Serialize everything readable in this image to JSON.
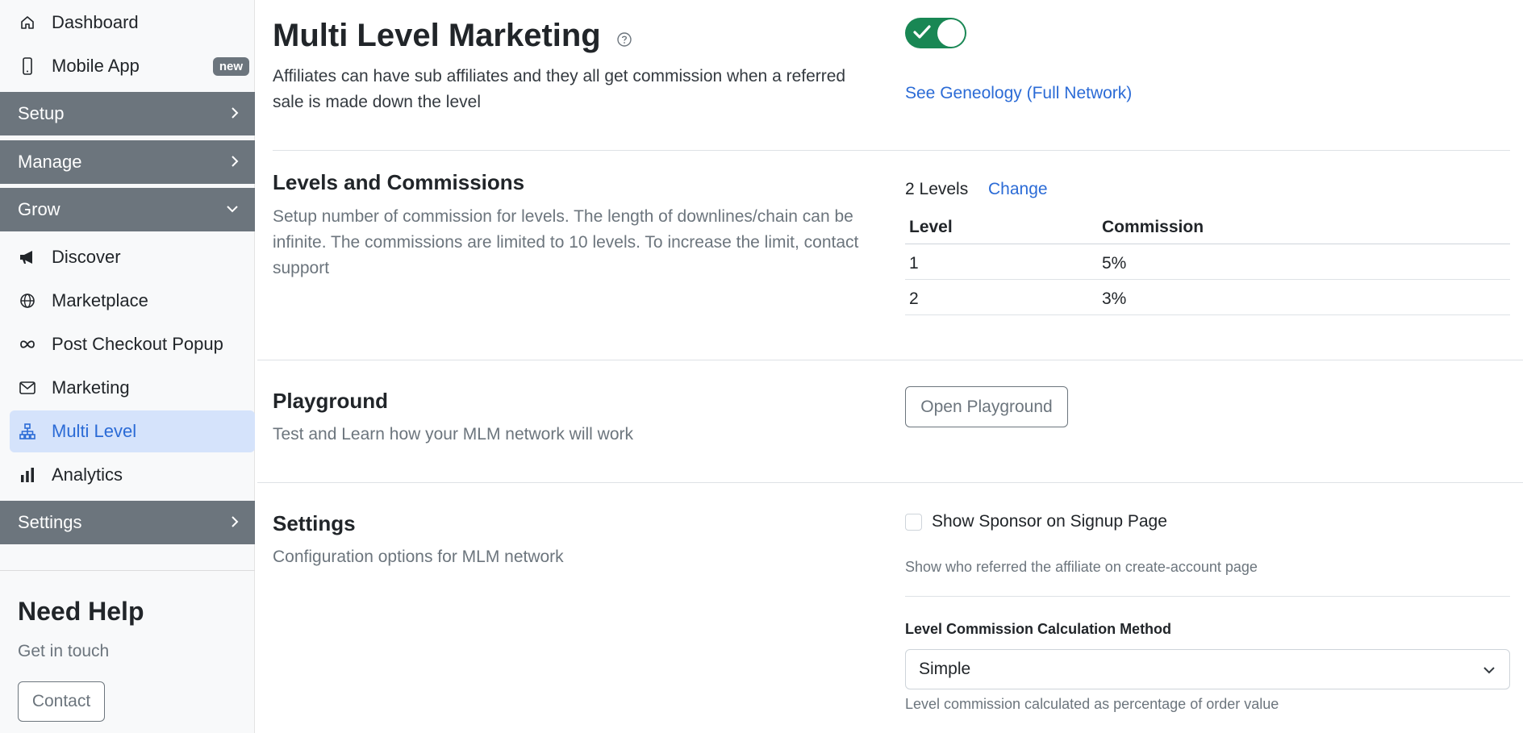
{
  "sidebar": {
    "items_top": [
      {
        "label": "Dashboard",
        "icon": "home-icon"
      },
      {
        "label": "Mobile App",
        "icon": "phone-icon",
        "badge": "new"
      }
    ],
    "sections": [
      {
        "label": "Setup",
        "state": "collapsed"
      },
      {
        "label": "Manage",
        "state": "collapsed"
      },
      {
        "label": "Grow",
        "state": "expanded"
      },
      {
        "label": "Settings",
        "state": "collapsed"
      }
    ],
    "grow_items": [
      {
        "label": "Discover",
        "icon": "megaphone-icon"
      },
      {
        "label": "Marketplace",
        "icon": "globe-icon"
      },
      {
        "label": "Post Checkout Popup",
        "icon": "infinity-icon"
      },
      {
        "label": "Marketing",
        "icon": "envelope-icon"
      },
      {
        "label": "Multi Level",
        "icon": "network-icon",
        "active": true
      },
      {
        "label": "Analytics",
        "icon": "bar-chart-icon"
      }
    ],
    "help": {
      "title": "Need Help",
      "subtitle": "Get in touch",
      "button": "Contact"
    }
  },
  "main": {
    "title": "Multi Level Marketing",
    "title_help_icon": "question-circle-icon",
    "description": "Affiliates can have sub affiliates and they all get commission when a referred sale is made down the level",
    "enabled": true,
    "genealogy_link": "See Geneology (Full Network)",
    "levels": {
      "heading": "Levels and Commissions",
      "description": "Setup number of commission for levels. The length of downlines/chain can be infinite. The commissions are limited to 10 levels. To increase the limit, contact support",
      "count_text": "2 Levels",
      "change_link": "Change",
      "table": {
        "headers": [
          "Level",
          "Commission"
        ],
        "rows": [
          [
            "1",
            "5%"
          ],
          [
            "2",
            "3%"
          ]
        ]
      }
    },
    "playground": {
      "heading": "Playground",
      "description": "Test and Learn how your MLM network will work",
      "button": "Open Playground"
    },
    "settings": {
      "heading": "Settings",
      "description": "Configuration options for MLM network",
      "show_sponsor_label": "Show Sponsor on Signup Page",
      "show_sponsor_checked": false,
      "show_sponsor_help": "Show who referred the affiliate on create-account page",
      "calc_method_label": "Level Commission Calculation Method",
      "calc_method_value": "Simple",
      "calc_method_help": "Level commission calculated as percentage of order value"
    }
  },
  "colors": {
    "accent": "#2b6bd6",
    "active_bg": "#d5e3fb",
    "section_bg": "#6c757d",
    "toggle_on": "#198754"
  }
}
